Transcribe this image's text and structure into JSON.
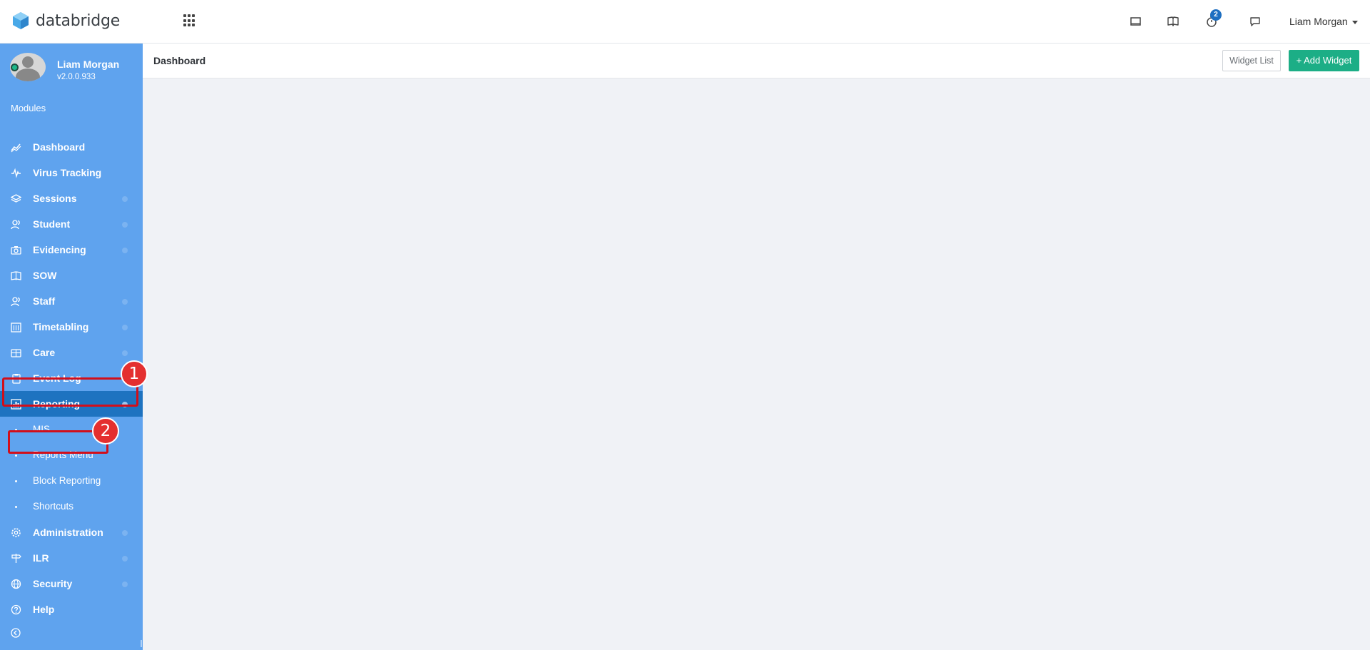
{
  "app": {
    "name": "databridge",
    "accent_color": "#5fa3ee",
    "active_color": "#1e73c0",
    "add_color": "#1cae86"
  },
  "topbar": {
    "apps_icon": "grid-icon",
    "icons": [
      "window-icon",
      "book-icon",
      "timer-icon",
      "chat-icon"
    ],
    "notification_count": "2",
    "user_name": "Liam Morgan"
  },
  "sidebar": {
    "user": {
      "name": "Liam Morgan",
      "version": "v2.0.0.933"
    },
    "section_label": "Modules",
    "items": [
      {
        "label": "Dashboard",
        "icon": "chart-line-icon"
      },
      {
        "label": "Virus Tracking",
        "icon": "pulse-icon"
      },
      {
        "label": "Sessions",
        "icon": "layers-icon"
      },
      {
        "label": "Student",
        "icon": "users-icon"
      },
      {
        "label": "Evidencing",
        "icon": "camera-icon"
      },
      {
        "label": "SOW",
        "icon": "book-open-icon"
      },
      {
        "label": "Staff",
        "icon": "users-icon"
      },
      {
        "label": "Timetabling",
        "icon": "calendar-icon"
      },
      {
        "label": "Care",
        "icon": "id-card-icon"
      },
      {
        "label": "Event Log",
        "icon": "clipboard-icon"
      },
      {
        "label": "Reporting",
        "icon": "bar-chart-icon"
      },
      {
        "label": "Administration",
        "icon": "gear-icon"
      },
      {
        "label": "ILR",
        "icon": "signpost-icon"
      },
      {
        "label": "Security",
        "icon": "globe-icon"
      },
      {
        "label": "Help",
        "icon": "question-circle-icon"
      }
    ],
    "reporting_subitems": [
      {
        "label": "MIS"
      },
      {
        "label": "Reports Menu"
      },
      {
        "label": "Block Reporting"
      },
      {
        "label": "Shortcuts"
      }
    ]
  },
  "main": {
    "title": "Dashboard",
    "widget_list_label": "Widget List",
    "add_widget_label": "+ Add Widget"
  },
  "annotations": [
    {
      "number": "1",
      "target": "Reporting"
    },
    {
      "number": "2",
      "target": "Reports Menu"
    }
  ]
}
